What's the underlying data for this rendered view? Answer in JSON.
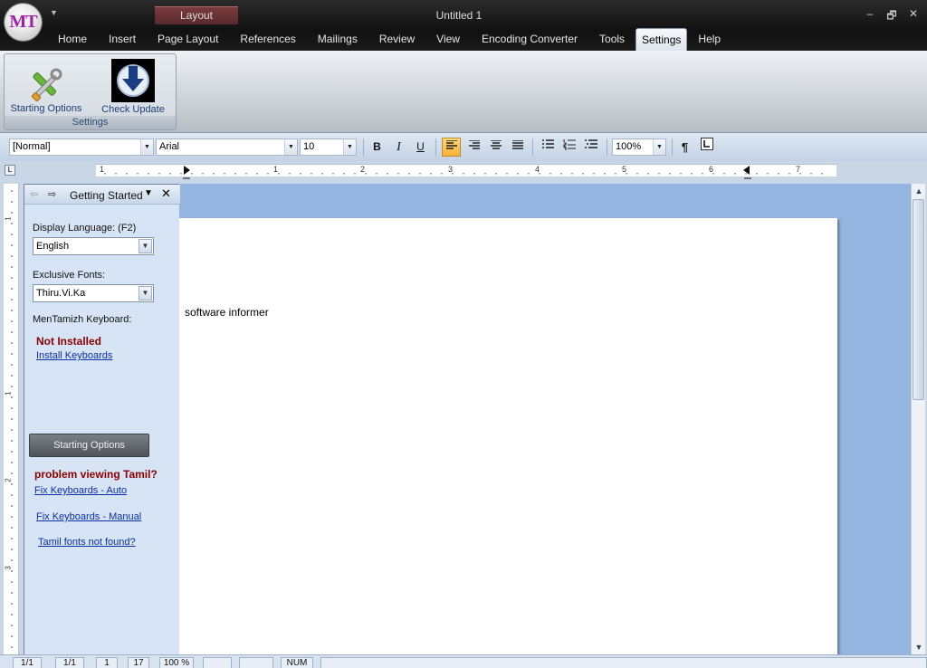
{
  "titlebar": {
    "logo_text": "MT",
    "context_tab": "Layout",
    "document_title": "Untitled 1",
    "window_controls": [
      "–",
      "🗗",
      "✕"
    ]
  },
  "menu": {
    "items": [
      "Home",
      "Insert",
      "Page Layout",
      "References",
      "Mailings",
      "Review",
      "View",
      "Encoding Converter",
      "Tools",
      "Settings",
      "Help"
    ],
    "active": "Settings"
  },
  "ribbon": {
    "buttons": [
      {
        "label": "Starting Options",
        "icon": "tools-icon"
      },
      {
        "label": "Check Update",
        "icon": "download-arrow-icon"
      }
    ],
    "group_label": "Settings"
  },
  "format_toolbar": {
    "style_value": "[Normal]",
    "font_value": "Arial",
    "size_value": "10",
    "bold": "B",
    "italic": "I",
    "underline": "U",
    "zoom_value": "100%",
    "pilcrow": "¶"
  },
  "ruler": {
    "numbers": [
      "1",
      "1",
      "2",
      "3",
      "4",
      "5",
      "6",
      "7"
    ],
    "vertical_numbers": [
      "1",
      "1",
      "2",
      "3"
    ]
  },
  "document": {
    "body_text": "software informer"
  },
  "task_pane": {
    "title": "Getting Started",
    "display_language_label": "Display Language: (F2)",
    "display_language_value": "English",
    "exclusive_fonts_label": "Exclusive Fonts:",
    "exclusive_fonts_value": "Thiru.Vi.Ka",
    "keyboard_label": "MenTamizh Keyboard:",
    "keyboard_status": "Not Installed",
    "install_link": "Install Keyboards",
    "starting_options_button": "Starting Options",
    "problem_heading": "problem viewing Tamil?",
    "fix_auto_link": "Fix Keyboards - Auto",
    "fix_manual_link": "Fix Keyboards - Manual",
    "fonts_not_found_link": "Tamil fonts not found?"
  },
  "statusbar": {
    "cells": [
      "1/1",
      "1/1",
      "1",
      "17",
      "100 %",
      "",
      "",
      "NUM",
      ""
    ]
  },
  "colors": {
    "accent_active_button": "#f7b13a",
    "workspace_blue": "#95b5e1",
    "link_blue": "#0a2ea8",
    "warning_red": "#8b0000"
  }
}
